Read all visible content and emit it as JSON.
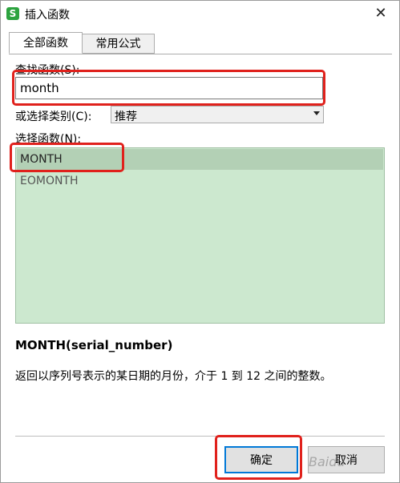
{
  "window": {
    "title": "插入函数",
    "app_icon_glyph": "S",
    "close_glyph": "✕"
  },
  "tabs": [
    {
      "label": "全部函数",
      "active": true
    },
    {
      "label": "常用公式",
      "active": false
    }
  ],
  "search": {
    "label": "查找函数(S):",
    "value": "month"
  },
  "category": {
    "label": "或选择类别(C):",
    "selected": "推荐"
  },
  "function_list": {
    "label": "选择函数(N):",
    "items": [
      {
        "name": "MONTH",
        "selected": true
      },
      {
        "name": "EOMONTH",
        "selected": false
      }
    ]
  },
  "description": {
    "signature": "MONTH(serial_number)",
    "text": "返回以序列号表示的某日期的月份，介于 1 到 12 之间的整数。"
  },
  "buttons": {
    "ok_label": "确定",
    "cancel_label": "取消"
  },
  "watermark": "Baidu",
  "colors": {
    "list_background": "#cce8cf",
    "list_selected": "#b3d0b5",
    "annotation_red": "#e0211c",
    "ok_focus_border": "#0078d7",
    "app_icon_green": "#2ca33f"
  }
}
